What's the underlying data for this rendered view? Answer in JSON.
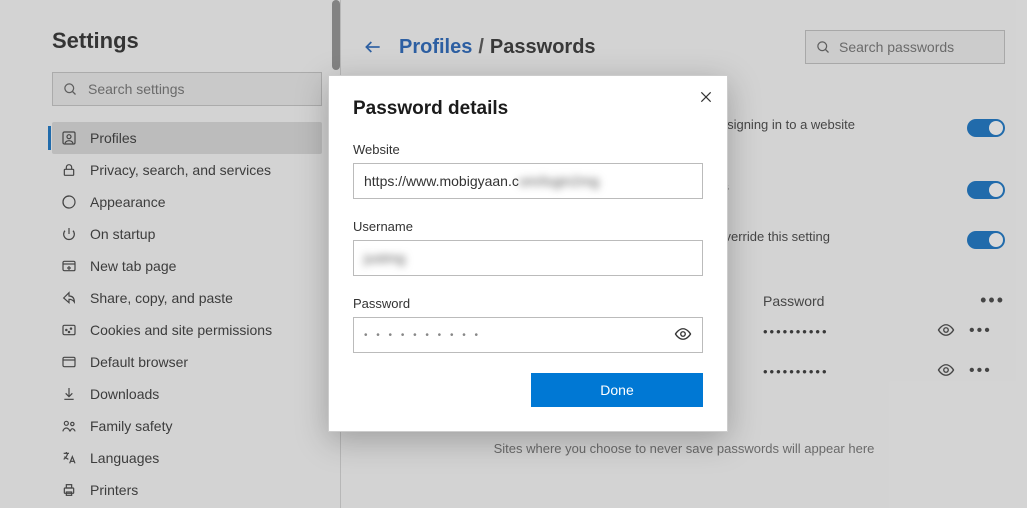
{
  "sidebar": {
    "title": "Settings",
    "search_placeholder": "Search settings",
    "items": [
      {
        "label": "Profiles",
        "icon": "profile-icon",
        "active": true
      },
      {
        "label": "Privacy, search, and services",
        "icon": "lock-icon"
      },
      {
        "label": "Appearance",
        "icon": "appearance-icon"
      },
      {
        "label": "On startup",
        "icon": "power-icon"
      },
      {
        "label": "New tab page",
        "icon": "newtab-icon"
      },
      {
        "label": "Share, copy, and paste",
        "icon": "share-icon"
      },
      {
        "label": "Cookies and site permissions",
        "icon": "cookies-icon"
      },
      {
        "label": "Default browser",
        "icon": "browser-icon"
      },
      {
        "label": "Downloads",
        "icon": "download-icon"
      },
      {
        "label": "Family safety",
        "icon": "family-icon"
      },
      {
        "label": "Languages",
        "icon": "language-icon"
      },
      {
        "label": "Printers",
        "icon": "printer-icon"
      }
    ]
  },
  "header": {
    "profiles_link": "Profiles",
    "separator": "/",
    "current": "Passwords",
    "search_placeholder": "Search passwords"
  },
  "toggles": {
    "row1_trail": "re signing in to a website",
    "row2_trail": "ds",
    "row2_sub": "override this setting"
  },
  "pw_table": {
    "password_col": "Password",
    "mask": "••••••••••",
    "more": "•••"
  },
  "never_note": "Sites where you choose to never save passwords will appear here",
  "modal": {
    "title": "Password details",
    "website_label": "Website",
    "website_value_visible": "https://www.mobigyaan.c",
    "website_value_blurred": "om/login2mg",
    "username_label": "Username",
    "username_value_blurred": "justmg",
    "password_label": "Password",
    "password_mask": "• • • • • • • • • •",
    "done": "Done"
  }
}
